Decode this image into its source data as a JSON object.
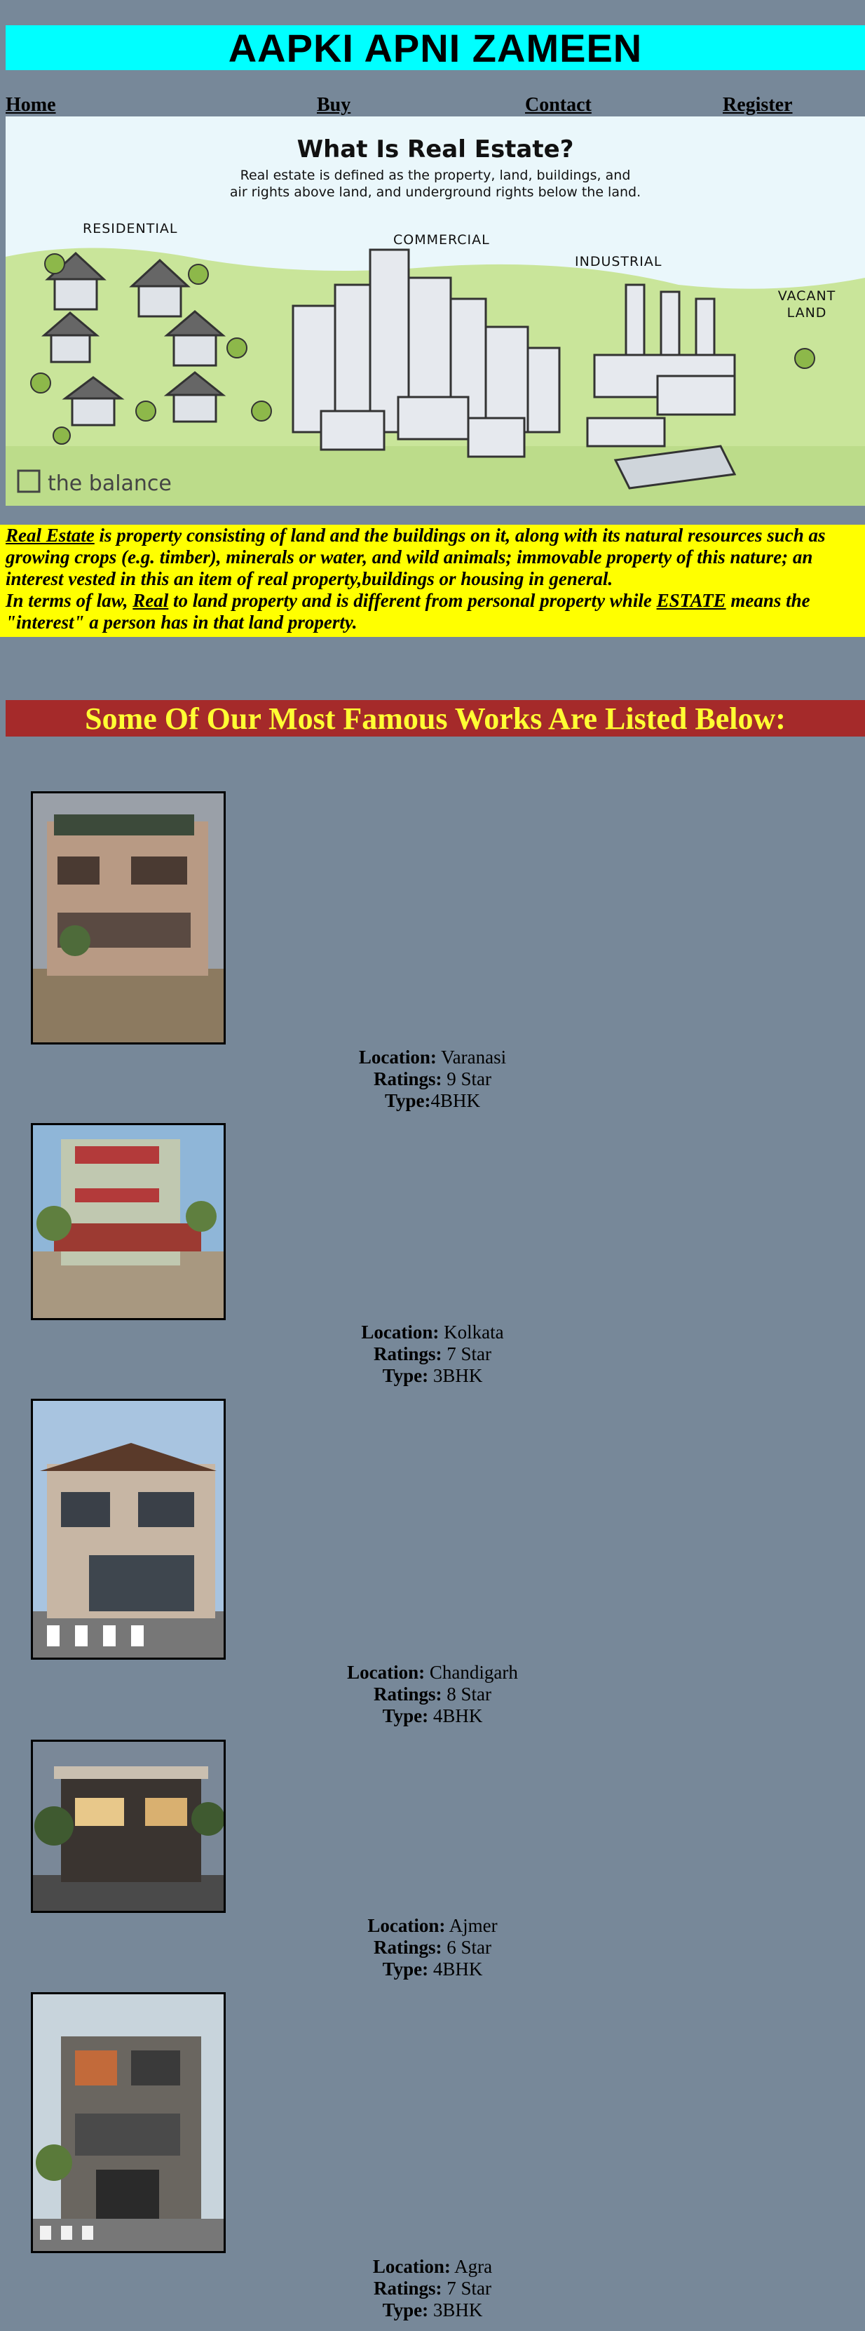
{
  "site": {
    "title": "AAPKI APNI ZAMEEN"
  },
  "nav": {
    "items": [
      "Home",
      "Buy",
      "Contact",
      "Register"
    ]
  },
  "hero": {
    "heading": "What Is Real Estate?",
    "subtext_line1": "Real estate is defined as the property, land, buildings, and",
    "subtext_line2": "air rights above land, and underground rights below the land.",
    "label_residential": "RESIDENTIAL",
    "label_commercial": "COMMERCIAL",
    "label_industrial": "INDUSTRIAL",
    "label_vacant_1": "VACANT",
    "label_vacant_2": "LAND",
    "brand": "the balance"
  },
  "intro": {
    "p1_link": "Real Estate",
    "p1_text": " is property consisting of land and the buildings on it, along with its natural resources such as growing crops (e.g. timber), minerals or water, and wild animals; immovable property of this nature; an interest vested in this an item of real property,buildings or housing in general.",
    "p2_a": "In terms of law, ",
    "p2_link1": "Real",
    "p2_b": " to land property and is different from personal property while ",
    "p2_link2": "ESTATE",
    "p2_c": " means the \"interest\" a person has in that land property."
  },
  "works": {
    "heading": "Some Of Our Most Famous Works Are Listed Below:",
    "location_label": "Location:",
    "ratings_label": "Ratings:",
    "type_label": "Type:",
    "items": [
      {
        "location": "Varanasi",
        "ratings": "9 Star",
        "type": "4BHK"
      },
      {
        "location": "Kolkata",
        "ratings": "7 Star",
        "type": "3BHK"
      },
      {
        "location": "Chandigarh",
        "ratings": "8 Star",
        "type": "4BHK"
      },
      {
        "location": "Ajmer",
        "ratings": "6 Star",
        "type": "4BHK"
      },
      {
        "location": "Agra",
        "ratings": "7 Star",
        "type": "3BHK"
      }
    ]
  }
}
